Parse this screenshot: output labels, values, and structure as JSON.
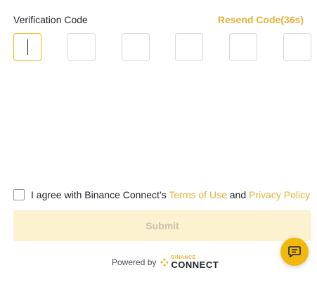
{
  "verification": {
    "label": "Verification Code",
    "resend_label": "Resend Code(36s)",
    "digits": [
      "",
      "",
      "",
      "",
      "",
      ""
    ]
  },
  "agreement": {
    "prefix": "I agree with Binance Connect’s ",
    "terms_link": "Terms of Use",
    "conjunction": " and ",
    "privacy_link": "Privacy Policy",
    "checked": false
  },
  "submit_label": "Submit",
  "footer": {
    "powered_by": "Powered by",
    "logo_small": "BINANCE",
    "logo_big": "CONNECT"
  },
  "chat": {
    "icon": "chat-icon"
  },
  "colors": {
    "accent": "#f0b90b",
    "link": "#e4b23a",
    "submit_bg": "#fdf2cf",
    "submit_text": "#c9c2ad"
  }
}
